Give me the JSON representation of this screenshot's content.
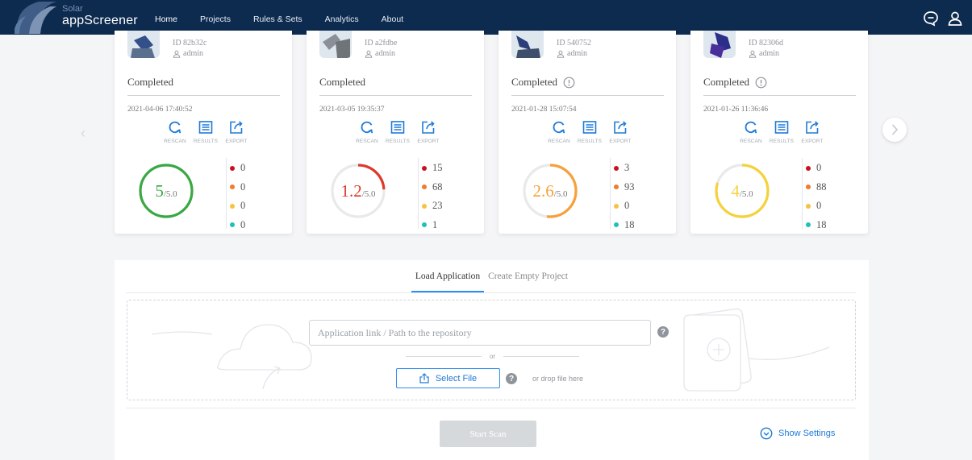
{
  "app": {
    "brand_sub": "Solar",
    "brand_name": "appScreener"
  },
  "nav": [
    {
      "label": "Home",
      "active": true
    },
    {
      "label": "Projects"
    },
    {
      "label": "Rules & Sets"
    },
    {
      "label": "Analytics"
    },
    {
      "label": "About"
    }
  ],
  "header_icons": [
    "chat-icon",
    "user-icon"
  ],
  "cards": [
    {
      "id": "ID 82b32c",
      "user": "admin",
      "status": "Completed",
      "has_warning": false,
      "date": "2021-04-06 17:40:52",
      "actions": [
        "RESCAN",
        "RESULTS",
        "EXPORT"
      ],
      "score": "5",
      "score_max": "/5.0",
      "score_fraction": 1.0,
      "score_color": "#39a844",
      "counts": [
        "0",
        "0",
        "0",
        "0"
      ]
    },
    {
      "id": "ID a2fdbe",
      "user": "admin",
      "status": "Completed",
      "has_warning": false,
      "date": "2021-03-05 19:35:37",
      "actions": [
        "RESCAN",
        "RESULTS",
        "EXPORT"
      ],
      "score": "1.2",
      "score_max": "/5.0",
      "score_fraction": 0.24,
      "score_color": "#e0392b",
      "counts": [
        "15",
        "68",
        "23",
        "1"
      ]
    },
    {
      "id": "ID 540752",
      "user": "admin",
      "status": "Completed",
      "has_warning": true,
      "date": "2021-01-28 15:07:54",
      "actions": [
        "RESCAN",
        "RESULTS",
        "EXPORT"
      ],
      "score": "2.6",
      "score_max": "/5.0",
      "score_fraction": 0.52,
      "score_color": "#f7a13a",
      "counts": [
        "3",
        "93",
        "0",
        "18"
      ]
    },
    {
      "id": "ID 82306d",
      "user": "admin",
      "status": "Completed",
      "has_warning": true,
      "date": "2021-01-26 11:36:46",
      "actions": [
        "RESCAN",
        "RESULTS",
        "EXPORT"
      ],
      "score": "4",
      "score_max": "/5.0",
      "score_fraction": 0.8,
      "score_color": "#f5d23c",
      "counts": [
        "0",
        "88",
        "0",
        "18"
      ]
    }
  ],
  "severity_colors": [
    "#c8101f",
    "#f07c2e",
    "#f5c242",
    "#1fc2b4"
  ],
  "load": {
    "tabs": [
      {
        "label": "Load Application",
        "active": true
      },
      {
        "label": "Create Empty Project"
      }
    ],
    "input_placeholder": "Application link / Path to the repository",
    "or_label": "or",
    "select_file_label": "Select File",
    "drop_label": "or drop file here",
    "start_label": "Start Scan",
    "settings_label": "Show Settings"
  },
  "colors": {
    "header": "#0d2a4f",
    "accent": "#2e8ef0",
    "link": "#1f7ad6"
  }
}
